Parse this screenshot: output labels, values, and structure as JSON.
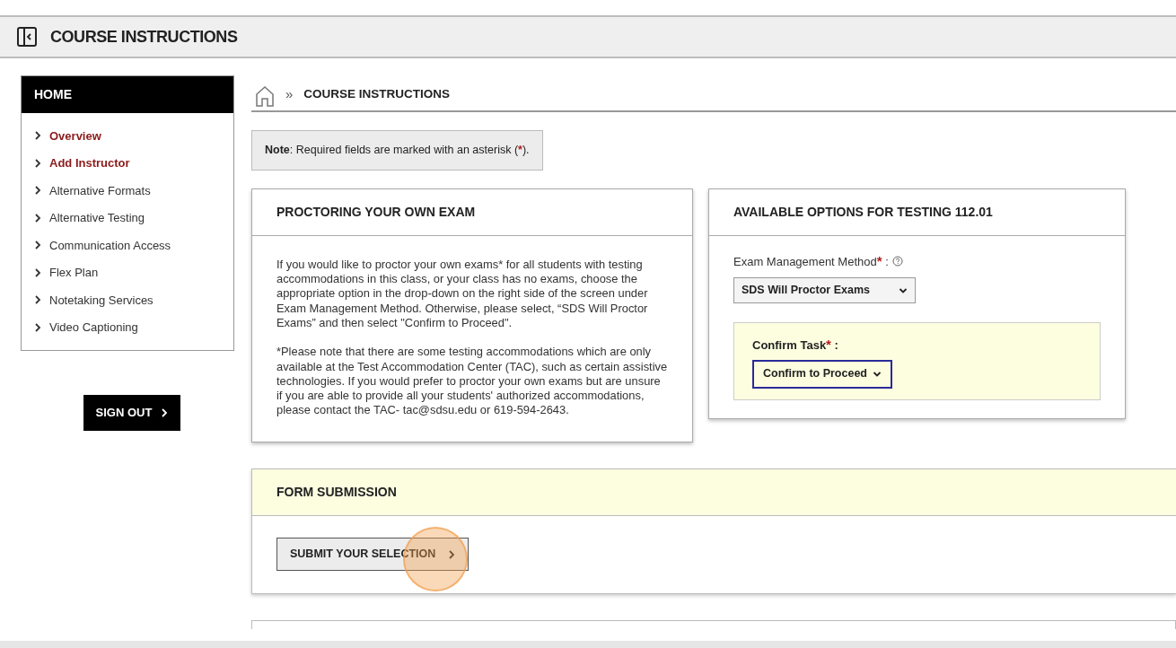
{
  "header": {
    "title": "COURSE INSTRUCTIONS"
  },
  "sidebar": {
    "title": "HOME",
    "items": [
      {
        "label": "Overview",
        "visited": true
      },
      {
        "label": "Add Instructor",
        "visited": true
      },
      {
        "label": "Alternative Formats",
        "visited": false
      },
      {
        "label": "Alternative Testing",
        "visited": false
      },
      {
        "label": "Communication Access",
        "visited": false
      },
      {
        "label": "Flex Plan",
        "visited": false
      },
      {
        "label": "Notetaking Services",
        "visited": false
      },
      {
        "label": "Video Captioning",
        "visited": false
      }
    ],
    "sign_out": "SIGN OUT"
  },
  "breadcrumb": {
    "separator": "»",
    "current": "COURSE INSTRUCTIONS"
  },
  "note": {
    "text": "**Note**: Required fields are marked with an asterisk (",
    "mark": "*",
    "end": ")."
  },
  "proctoring": {
    "title": "PROCTORING YOUR OWN EXAM",
    "paragraphs": [
      "If you would like to proctor your own exams* for all students with testing accommodations in this class, or your class has no exams, choose the appropriate option in the drop-down on the right side of the screen under Exam Management Method. Otherwise, please select, “SDS Will Proctor Exams” and then select \"Confirm to Proceed\".",
      "*Please note that there are some testing accommodations which are only available at the Test Accommodation Center (TAC), such as certain assistive technologies. If you would prefer to proctor your own exams but are unsure if you are able to provide all your students' authorized accommodations, please contact the TAC- tac@sdsu.edu or 619-594-2643."
    ]
  },
  "options": {
    "title": "AVAILABLE OPTIONS FOR TESTING 112.01",
    "method": {
      "label": "Exam Management Method",
      "required_mark": "*",
      "colon": ":",
      "value": "SDS Will Proctor Exams"
    },
    "confirm": {
      "label": "Confirm Task",
      "required_mark": "*",
      "colon": ":",
      "value": "Confirm to Proceed",
      "focused": true
    }
  },
  "submission": {
    "title": "FORM SUBMISSION",
    "button": "SUBMIT YOUR SELECTION",
    "click_highlight": true
  }
}
